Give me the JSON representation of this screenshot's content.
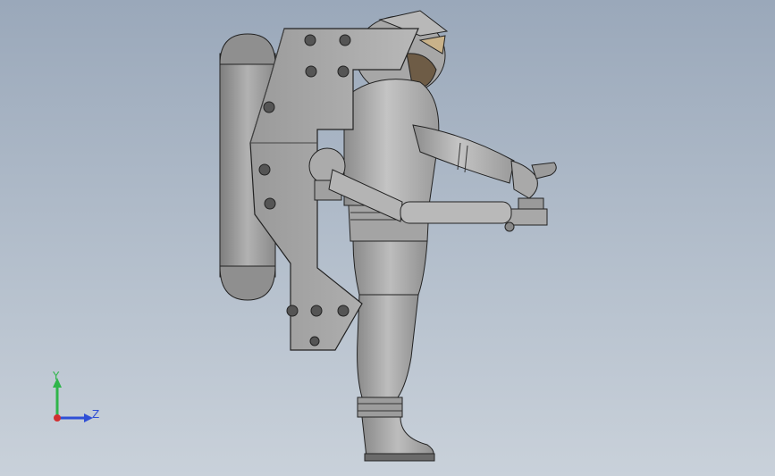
{
  "triad": {
    "y_label": "Y",
    "z_label": "Z",
    "y_color": "#2fb54a",
    "z_color": "#2f4fd6",
    "x_color": "#d23030"
  },
  "model": {
    "icon": "astronaut-jetpack-model"
  }
}
